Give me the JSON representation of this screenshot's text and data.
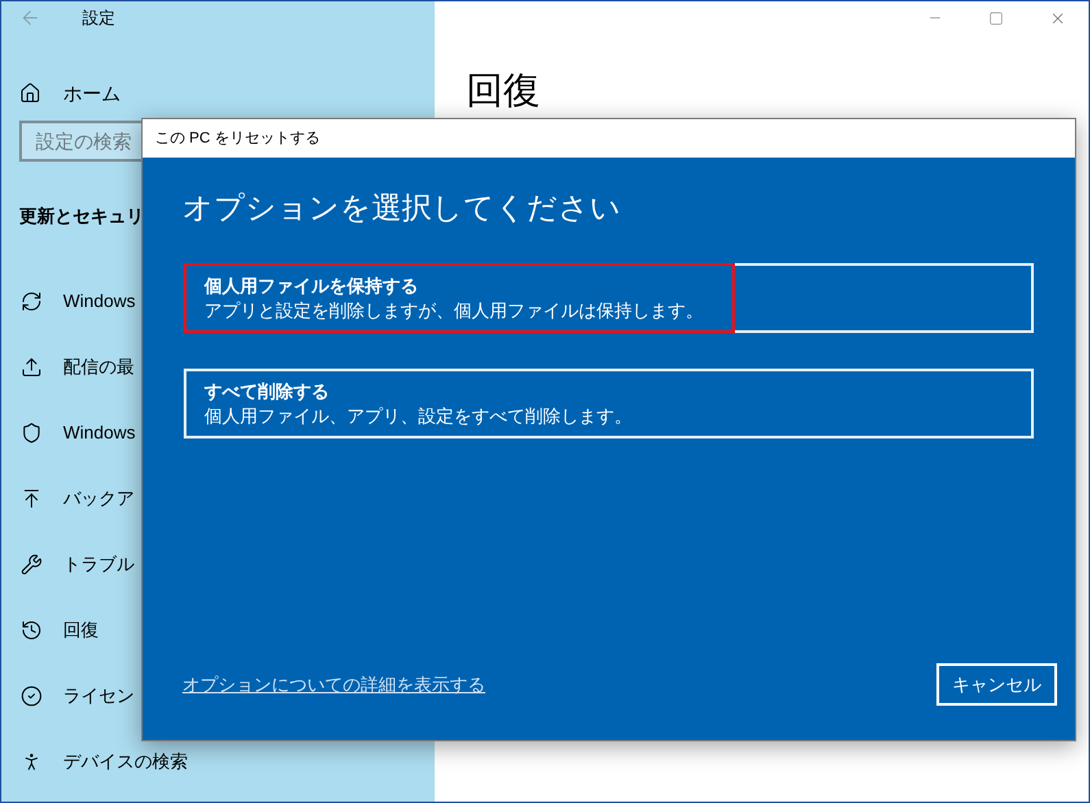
{
  "settings_window": {
    "title": "設定",
    "home": "ホーム",
    "search": {
      "placeholder": "設定の検索"
    },
    "section_header": "更新とセキュリ",
    "nav_items": [
      {
        "label": "Windows"
      },
      {
        "label": "配信の最"
      },
      {
        "label": "Windows"
      },
      {
        "label": "バックア"
      },
      {
        "label": "トラブル"
      },
      {
        "label": "回復"
      },
      {
        "label": "ライセン"
      },
      {
        "label": "デバイスの検索"
      }
    ],
    "page_title": "回復"
  },
  "dialog": {
    "title": "この PC をリセットする",
    "heading": "オプションを選択してください",
    "options": [
      {
        "title": "個人用ファイルを保持する",
        "description": "アプリと設定を削除しますが、個人用ファイルは保持します。",
        "highlighted": true
      },
      {
        "title": "すべて削除する",
        "description": "個人用ファイル、アプリ、設定をすべて削除します。",
        "highlighted": false
      }
    ],
    "link": "オプションについての詳細を表示する",
    "cancel_button": "キャンセル"
  }
}
